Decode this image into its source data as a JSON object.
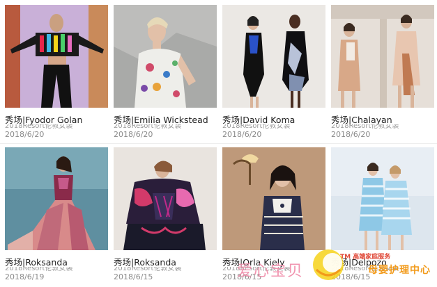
{
  "cards": [
    {
      "title": "秀场|Fyodor Golan",
      "subtitle": "2018Resort伦敦女装",
      "date": "2018/6/20"
    },
    {
      "title": "秀场|Emilia Wickstead",
      "subtitle": "2018Resort伦敦女装",
      "date": "2018/6/20"
    },
    {
      "title": "秀场|David Koma",
      "subtitle": "2018Resort伦敦女装",
      "date": "2018/6/20"
    },
    {
      "title": "秀场|Chalayan",
      "subtitle": "2018Resort伦敦女装",
      "date": "2018/6/20"
    },
    {
      "title": "秀场|Roksanda",
      "subtitle": "2018Resort伦敦女装",
      "date": "2018/6/19"
    },
    {
      "title": "秀场|Roksanda",
      "subtitle": "2018Resort伦敦女装",
      "date": "2018/6/15"
    },
    {
      "title": "秀场|Orla Kiely",
      "subtitle": "2018Resort伦敦女装",
      "date": "2018/6/15"
    },
    {
      "title": "秀场|Delpozo",
      "subtitle": "2018Resort伦敦女装",
      "date": "2018/6/15"
    }
  ],
  "watermark": {
    "main_text": "爱心宝贝",
    "tm_text": "TM 高端家庭服务",
    "sub_text": "母婴护理中心"
  }
}
